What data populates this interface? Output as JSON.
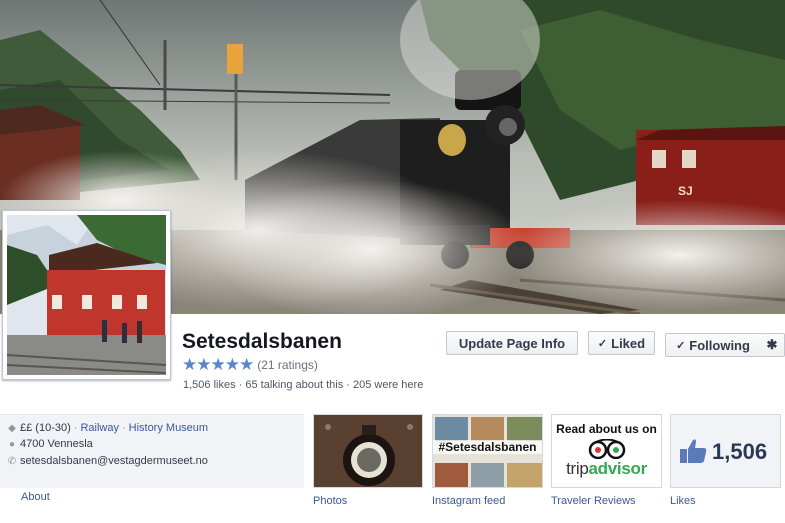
{
  "page": {
    "title": "Setesdalsbanen",
    "rating_stars": "★★★★★",
    "ratings_count": "(21 ratings)",
    "stats": "1,506 likes · 65 talking about this · 205 were here"
  },
  "buttons": {
    "update_page_info": "Update Page Info",
    "liked": "Liked",
    "following": "Following",
    "check": "✓",
    "gear": "✱"
  },
  "cover": {
    "wagon_text": "SJ"
  },
  "info": {
    "price": "££ (10-30)",
    "category_1": "Railway",
    "category_2": "History Museum",
    "address": "4700 Vennesla",
    "email": "setesdalsbanen@vestagdermuseet.no",
    "separator": "·",
    "about_label": "About"
  },
  "tiles": {
    "photos_label": "Photos",
    "instagram_label": "Instagram feed",
    "instagram_tag": "#Setesdalsbanen",
    "trip_label": "Traveler Reviews",
    "trip_read": "Read about us on",
    "trip_word_1": "trip",
    "trip_word_2": "advisor",
    "likes_label": "Likes",
    "likes_count": "1,506"
  },
  "colors": {
    "facebook_blue": "#3b5998",
    "star_blue": "#5b86c5",
    "tripadvisor_green": "#34a853"
  }
}
